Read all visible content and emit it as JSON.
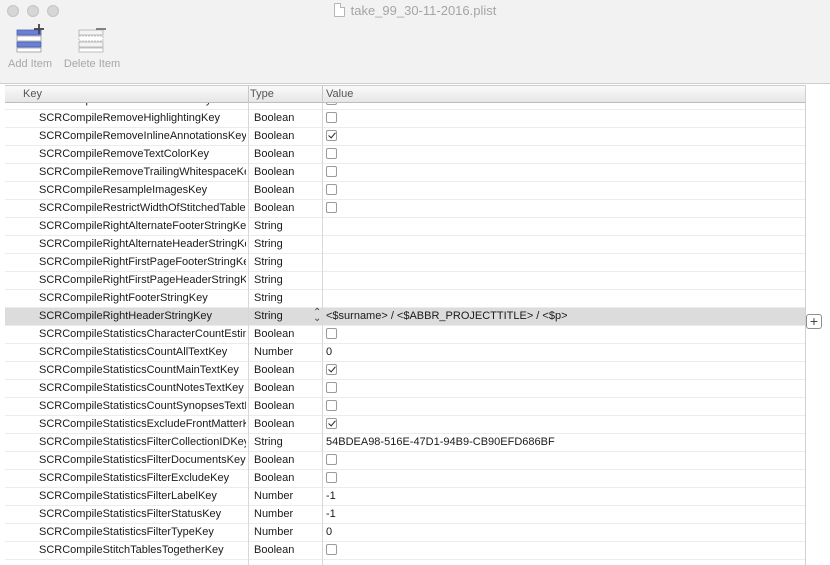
{
  "window": {
    "title": "take_99_30-11-2016.plist"
  },
  "toolbar": {
    "add_label": "Add Item",
    "delete_label": "Delete Item"
  },
  "columns": {
    "key": "Key",
    "type": "Type",
    "value": "Value"
  },
  "rows": [
    {
      "key": "SCRCompileRemoveFootnotesKey",
      "type": "Boolean",
      "value": "",
      "checked": false
    },
    {
      "key": "SCRCompileRemoveHighlightingKey",
      "type": "Boolean",
      "value": "",
      "checked": false
    },
    {
      "key": "SCRCompileRemoveInlineAnnotationsKey",
      "type": "Boolean",
      "value": "",
      "checked": true
    },
    {
      "key": "SCRCompileRemoveTextColorKey",
      "type": "Boolean",
      "value": "",
      "checked": false
    },
    {
      "key": "SCRCompileRemoveTrailingWhitespaceKey",
      "type": "Boolean",
      "value": "",
      "checked": false
    },
    {
      "key": "SCRCompileResampleImagesKey",
      "type": "Boolean",
      "value": "",
      "checked": false
    },
    {
      "key": "SCRCompileRestrictWidthOfStitchedTablesKey",
      "type": "Boolean",
      "value": "",
      "checked": false
    },
    {
      "key": "SCRCompileRightAlternateFooterStringKey",
      "type": "String",
      "value": ""
    },
    {
      "key": "SCRCompileRightAlternateHeaderStringKey",
      "type": "String",
      "value": ""
    },
    {
      "key": "SCRCompileRightFirstPageFooterStringKey",
      "type": "String",
      "value": ""
    },
    {
      "key": "SCRCompileRightFirstPageHeaderStringKey",
      "type": "String",
      "value": ""
    },
    {
      "key": "SCRCompileRightFooterStringKey",
      "type": "String",
      "value": ""
    },
    {
      "key": "SCRCompileRightHeaderStringKey",
      "type": "String",
      "value": "<$surname> / <$ABBR_PROJECTTITLE> / <$p>",
      "selected": true
    },
    {
      "key": "SCRCompileStatisticsCharacterCountEstimateKey",
      "type": "Boolean",
      "value": "",
      "checked": false
    },
    {
      "key": "SCRCompileStatisticsCountAllTextKey",
      "type": "Number",
      "value": "0"
    },
    {
      "key": "SCRCompileStatisticsCountMainTextKey",
      "type": "Boolean",
      "value": "",
      "checked": true
    },
    {
      "key": "SCRCompileStatisticsCountNotesTextKey",
      "type": "Boolean",
      "value": "",
      "checked": false
    },
    {
      "key": "SCRCompileStatisticsCountSynopsesTextKey",
      "type": "Boolean",
      "value": "",
      "checked": false
    },
    {
      "key": "SCRCompileStatisticsExcludeFrontMatterKey",
      "type": "Boolean",
      "value": "",
      "checked": true
    },
    {
      "key": "SCRCompileStatisticsFilterCollectionIDKey",
      "type": "String",
      "value": "54BDEA98-516E-47D1-94B9-CB90EFD686BF"
    },
    {
      "key": "SCRCompileStatisticsFilterDocumentsKey",
      "type": "Boolean",
      "value": "",
      "checked": false
    },
    {
      "key": "SCRCompileStatisticsFilterExcludeKey",
      "type": "Boolean",
      "value": "",
      "checked": false
    },
    {
      "key": "SCRCompileStatisticsFilterLabelKey",
      "type": "Number",
      "value": "-1"
    },
    {
      "key": "SCRCompileStatisticsFilterStatusKey",
      "type": "Number",
      "value": "-1"
    },
    {
      "key": "SCRCompileStatisticsFilterTypeKey",
      "type": "Number",
      "value": "0"
    },
    {
      "key": "SCRCompileStitchTablesTogetherKey",
      "type": "Boolean",
      "value": "",
      "checked": false
    }
  ]
}
